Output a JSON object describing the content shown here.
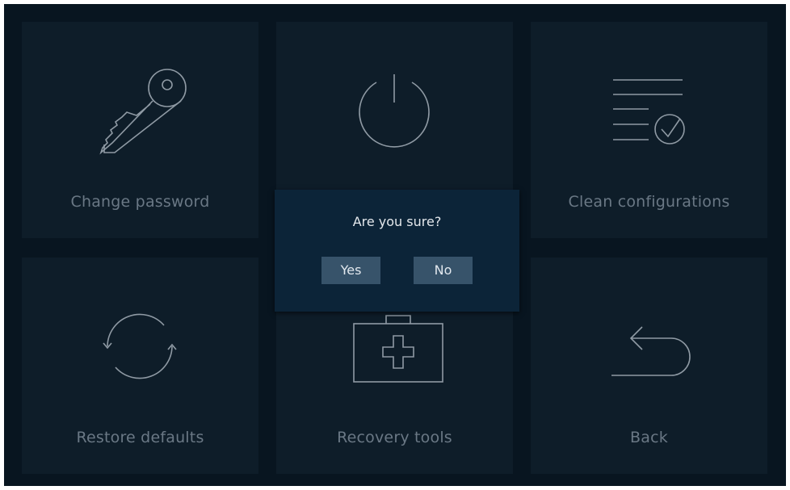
{
  "tiles": [
    {
      "label": "Change password",
      "icon": "key-icon"
    },
    {
      "label": "",
      "icon": "power-icon"
    },
    {
      "label": "Clean configurations",
      "icon": "checklist-icon"
    },
    {
      "label": "Restore defaults",
      "icon": "refresh-icon"
    },
    {
      "label": "Recovery tools",
      "icon": "first-aid-kit-icon"
    },
    {
      "label": "Back",
      "icon": "back-arrow-icon"
    }
  ],
  "dialog": {
    "message": "Are you sure?",
    "yes_label": "Yes",
    "no_label": "No"
  },
  "colors": {
    "background": "#081520",
    "tile": "#0e1d29",
    "dialog": "#0c2438",
    "dialog_button": "#37536a",
    "label_text": "#6a7885",
    "icon_stroke": "#8f9aa4"
  }
}
